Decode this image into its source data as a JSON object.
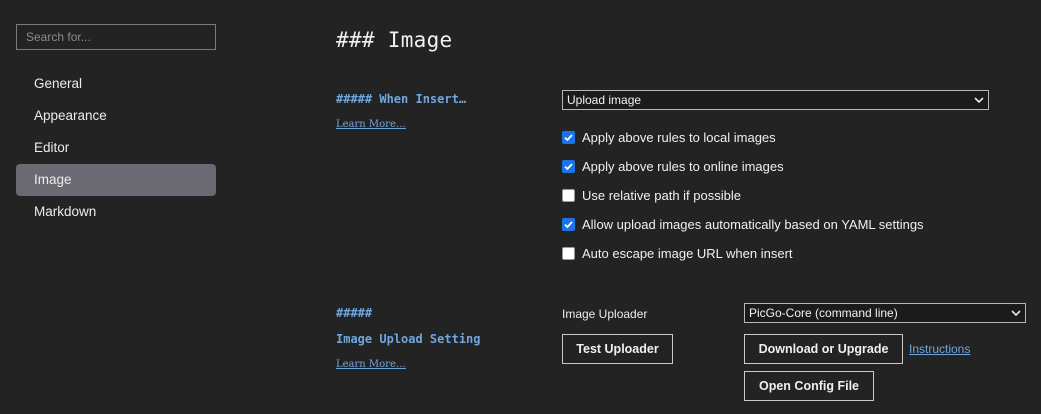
{
  "sidebar": {
    "search_placeholder": "Search for...",
    "items": [
      {
        "label": "General",
        "active": false
      },
      {
        "label": "Appearance",
        "active": false
      },
      {
        "label": "Editor",
        "active": false
      },
      {
        "label": "Image",
        "active": true
      },
      {
        "label": "Markdown",
        "active": false
      }
    ]
  },
  "main": {
    "title": "### Image",
    "when_insert": {
      "heading": "##### When Insert…",
      "learn_more": "Learn More…",
      "select_value": "Upload image"
    },
    "options": [
      {
        "label": "Apply above rules to local images",
        "checked": true
      },
      {
        "label": "Apply above rules to online images",
        "checked": true
      },
      {
        "label": "Use relative path if possible",
        "checked": false
      },
      {
        "label": "Allow upload images automatically based on YAML settings",
        "checked": true
      },
      {
        "label": "Auto escape image URL when insert",
        "checked": false
      }
    ],
    "upload": {
      "heading_hashes": "#####",
      "heading": "Image Upload Setting",
      "learn_more": "Learn More…",
      "uploader_label": "Image Uploader",
      "uploader_value": "PicGo-Core (command line)",
      "test_button": "Test Uploader",
      "download_button": "Download or Upgrade",
      "instructions_link": "Instructions",
      "open_config_button": "Open Config File"
    }
  },
  "colors": {
    "background": "#232323",
    "accent_blue": "#6fa6df",
    "checkbox_blue": "#1a73e8",
    "active_nav": "#6b6a72"
  }
}
